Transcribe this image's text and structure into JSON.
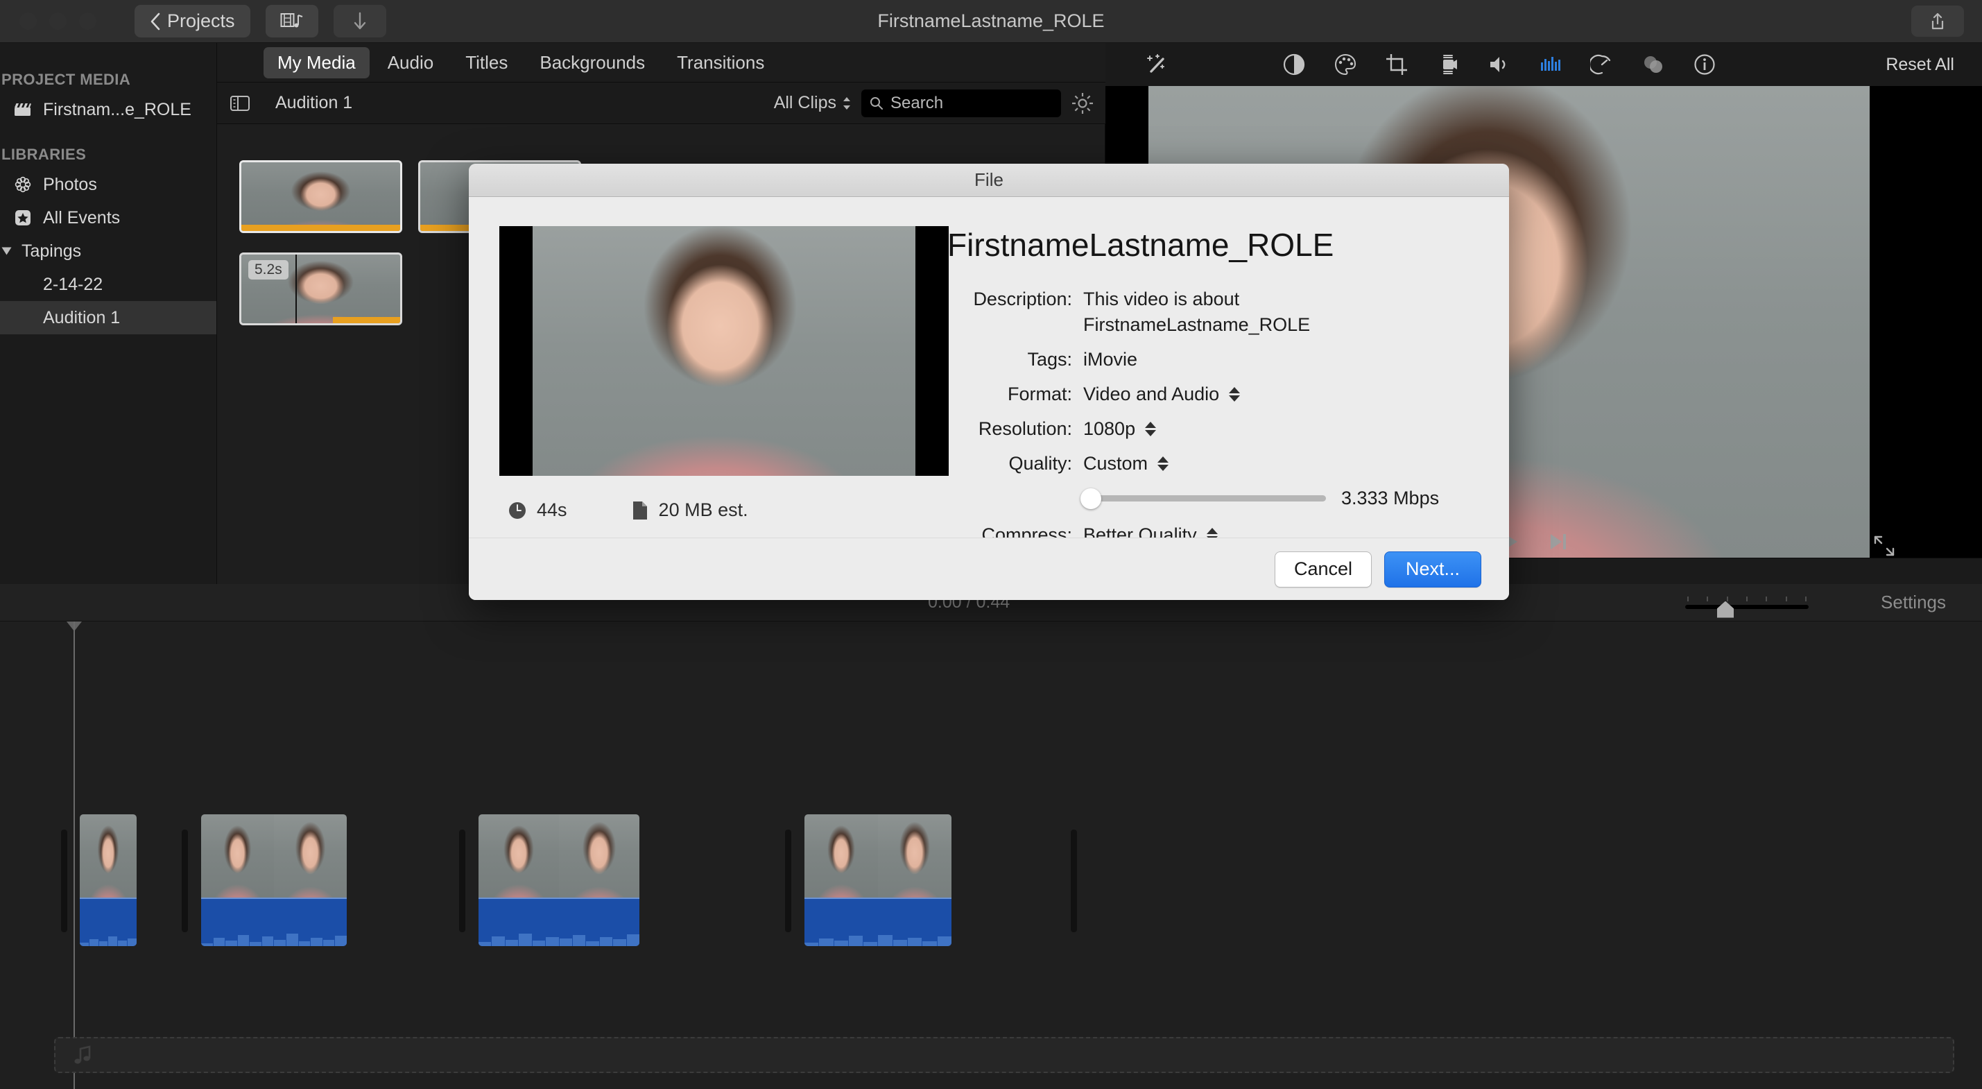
{
  "window": {
    "title": "FirstnameLastname_ROLE",
    "back_button": "Projects",
    "media_button_icon": "film-music-icon",
    "download_button_icon": "download-arrow-icon",
    "share_button_icon": "share-icon"
  },
  "sidebar": {
    "sections": [
      {
        "heading": "PROJECT MEDIA",
        "items": [
          {
            "label": "Firstnam...e_ROLE",
            "icon": "clapperboard-icon",
            "selected": false
          }
        ]
      },
      {
        "heading": "LIBRARIES",
        "items": [
          {
            "label": "Photos",
            "icon": "photos-icon",
            "selected": false
          },
          {
            "label": "All Events",
            "icon": "star-icon",
            "selected": false
          },
          {
            "label": "Tapings",
            "icon": "disclosure-triangle-icon",
            "selected": false
          },
          {
            "label": "2-14-22",
            "icon": "none",
            "selected": false,
            "indent": true
          },
          {
            "label": "Audition 1",
            "icon": "none",
            "selected": true,
            "indent": true
          }
        ]
      }
    ]
  },
  "browser": {
    "tabs": [
      {
        "label": "My Media",
        "active": true
      },
      {
        "label": "Audio",
        "active": false
      },
      {
        "label": "Titles",
        "active": false
      },
      {
        "label": "Backgrounds",
        "active": false
      },
      {
        "label": "Transitions",
        "active": false
      }
    ],
    "header": {
      "sidebar_toggle_icon": "sidebar-toggle-icon",
      "title": "Audition 1",
      "filter_label": "All Clips",
      "filter_icon": "updown-chevron-icon",
      "search_placeholder": "Search",
      "search_value": "",
      "search_icon": "search-icon",
      "settings_icon": "gear-icon"
    },
    "clips": [
      {
        "duration_badge": "",
        "selected": true
      },
      {
        "duration_badge": "5.2s",
        "selected": false
      }
    ]
  },
  "viewer": {
    "toolbar_icons": [
      "magic-wand-icon",
      "color-balance-icon",
      "color-correction-icon",
      "crop-icon",
      "stabilization-icon",
      "volume-icon",
      "equalizer-icon",
      "speed-icon",
      "clip-filter-icon",
      "info-icon"
    ],
    "reset_all_label": "Reset All",
    "play_icon": "play-icon",
    "skip-to-end_icon": "skip-to-end-icon",
    "fullscreen_icon": "expand-arrows-icon",
    "accent_color": "#2d7fe0"
  },
  "timeline": {
    "current_time": "0:00",
    "separator": "/",
    "total_time": "0:44",
    "settings_label": "Settings",
    "zoom_value": 30,
    "clips": 4,
    "music_drop_icon": "music-note-icon"
  },
  "dialog": {
    "titlebar": "File",
    "name": "FirstnameLastname_ROLE",
    "preview_duration": "44s",
    "preview_duration_icon": "clock-icon",
    "preview_size": "20 MB est.",
    "preview_size_icon": "document-icon",
    "fields": [
      {
        "label": "Description:",
        "value_lines": [
          "This video is about",
          "FirstnameLastname_ROLE"
        ],
        "stepper": false
      },
      {
        "label": "Tags:",
        "value_lines": [
          "iMovie"
        ],
        "stepper": false
      },
      {
        "label": "Format:",
        "value_lines": [
          "Video and Audio"
        ],
        "stepper": true
      },
      {
        "label": "Resolution:",
        "value_lines": [
          "1080p"
        ],
        "stepper": true
      },
      {
        "label": "Quality:",
        "value_lines": [
          "Custom"
        ],
        "stepper": true
      }
    ],
    "bitrate": "3.333 Mbps",
    "bitrate_slider_percent": 0,
    "compress_label": "Compress:",
    "compress_value": "Better Quality",
    "cancel_label": "Cancel",
    "next_label": "Next...",
    "primary_color": "#2472e0"
  }
}
